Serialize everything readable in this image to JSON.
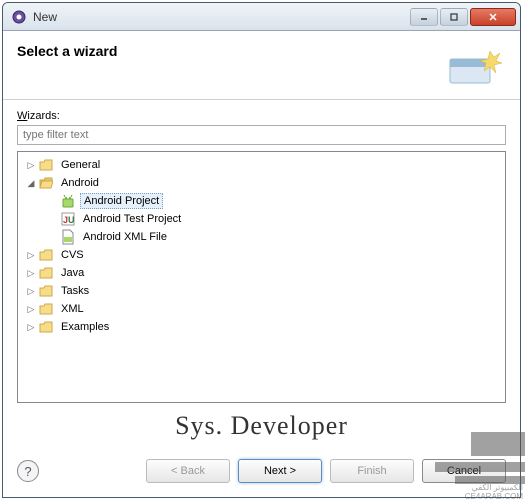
{
  "window": {
    "title": "New"
  },
  "header": {
    "title": "Select a wizard"
  },
  "filter": {
    "label_pre": "",
    "label_underline": "W",
    "label_post": "izards:",
    "placeholder": "type filter text"
  },
  "tree": {
    "general": "General",
    "android": "Android",
    "android_project": "Android Project",
    "android_test": "Android Test Project",
    "android_xml": "Android XML File",
    "cvs": "CVS",
    "java": "Java",
    "tasks": "Tasks",
    "xml": "XML",
    "examples": "Examples"
  },
  "buttons": {
    "back": "< Back",
    "next": "Next >",
    "finish": "Finish",
    "cancel": "Cancel"
  },
  "watermark": {
    "text": "Sys. Developer",
    "site": "CE4ARAB.COM",
    "arabic": "الكمبيوتر الكفي"
  }
}
